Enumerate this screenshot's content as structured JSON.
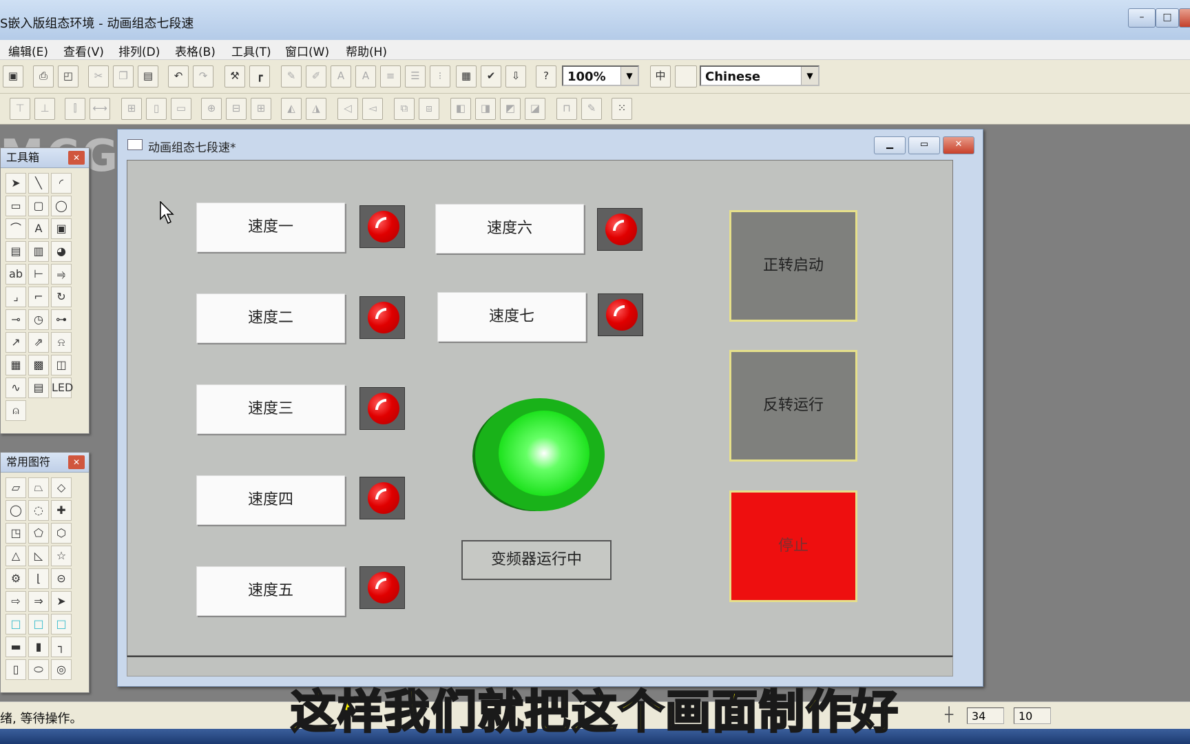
{
  "window": {
    "title": "S嵌入版组态环境 - 动画组态七段速",
    "minimize": "–",
    "maximize": "□",
    "close": "✕"
  },
  "menu": [
    "编辑(E)",
    "查看(V)",
    "排列(D)",
    "表格(B)",
    "工具(T)",
    "窗口(W)",
    "帮助(H)"
  ],
  "toolbar": {
    "zoom": "100%",
    "language": "Chinese"
  },
  "toolbox": {
    "title": "工具箱"
  },
  "symbols": {
    "title": "常用图符"
  },
  "child_window": {
    "title": "动画组态七段速*"
  },
  "canvas": {
    "speed_labels": [
      "速度一",
      "速度二",
      "速度三",
      "速度四",
      "速度五",
      "速度六",
      "速度七"
    ],
    "buttons": {
      "forward": "正转启动",
      "reverse": "反转运行",
      "stop": "停止"
    },
    "vfd_status": "变频器运行中",
    "lamp_color": "#e00000",
    "run_lamp_color": "#22dd22"
  },
  "status": {
    "message": "绪, 等待操作。",
    "x": "34",
    "y": "10"
  },
  "subtitle": "这样我们就把这个画面制作好"
}
